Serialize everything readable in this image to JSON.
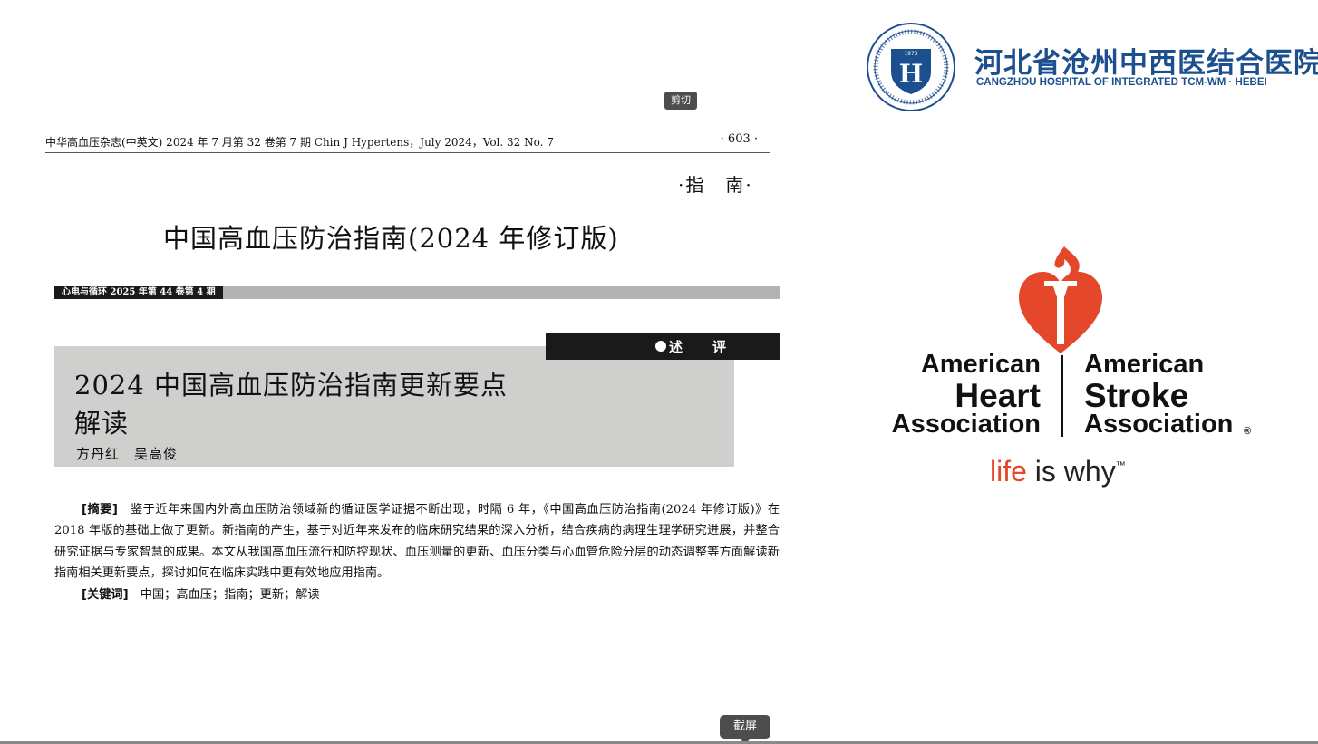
{
  "journal_header": {
    "left": "中华高血压杂志(中英文)  2024 年 7 月第 32 卷第 7 期  Chin J Hypertens，July 2024，Vol. 32 No. 7",
    "page": "· 603 ·"
  },
  "section_tag": "·指　南·",
  "paper_title": "中国高血压防治指南(2024 年修订版)",
  "band_label": "心电与循环 2025 年第 44 卷第 4 期",
  "review_label": "述　　评",
  "article": {
    "title_line1": "2024 中国高血压防治指南更新要点",
    "title_line2": "解读",
    "authors": "方丹红　吴高俊"
  },
  "abstract": {
    "label": "[摘要]",
    "text": "鉴于近年来国内外高血压防治领域新的循证医学证据不断出现，时隔 6 年，《中国高血压防治指南(2024 年修订版)》在 2018 年版的基础上做了更新。新指南的产生，基于对近年来发布的临床研究结果的深入分析，结合疾病的病理生理学研究进展，并整合研究证据与专家智慧的成果。本文从我国高血压流行和防控现状、血压测量的更新、血压分类与心血管危险分层的动态调整等方面解读新指南相关更新要点，探讨如何在临床实践中更有效地应用指南。"
  },
  "keywords": {
    "label": "[关键词]",
    "text": "中国；高血压；指南；更新；解读"
  },
  "tooltips": {
    "cut": "剪切",
    "screenshot": "截屏"
  },
  "hospital": {
    "name_cn": "河北省沧州中西医结合医院",
    "name_en": "CANGZHOU HOSPITAL OF INTEGRATED TCM-WM · HEBEI",
    "seal_year": "1973",
    "seal_letter": "H"
  },
  "aha": {
    "left_line1": "American",
    "left_line2": "Heart",
    "left_line3": "Association",
    "right_line1": "American",
    "right_line2": "Stroke",
    "right_line3": "Association",
    "registered": "®",
    "tagline_life": "life",
    "tagline_rest": " is why",
    "tagline_tm": "™",
    "brand_color": "#e4472a"
  },
  "colors": {
    "hospital_blue": "#1b4f8f",
    "title_box_bg": "#cfcfcd",
    "band_bg": "#b3b3b3"
  }
}
